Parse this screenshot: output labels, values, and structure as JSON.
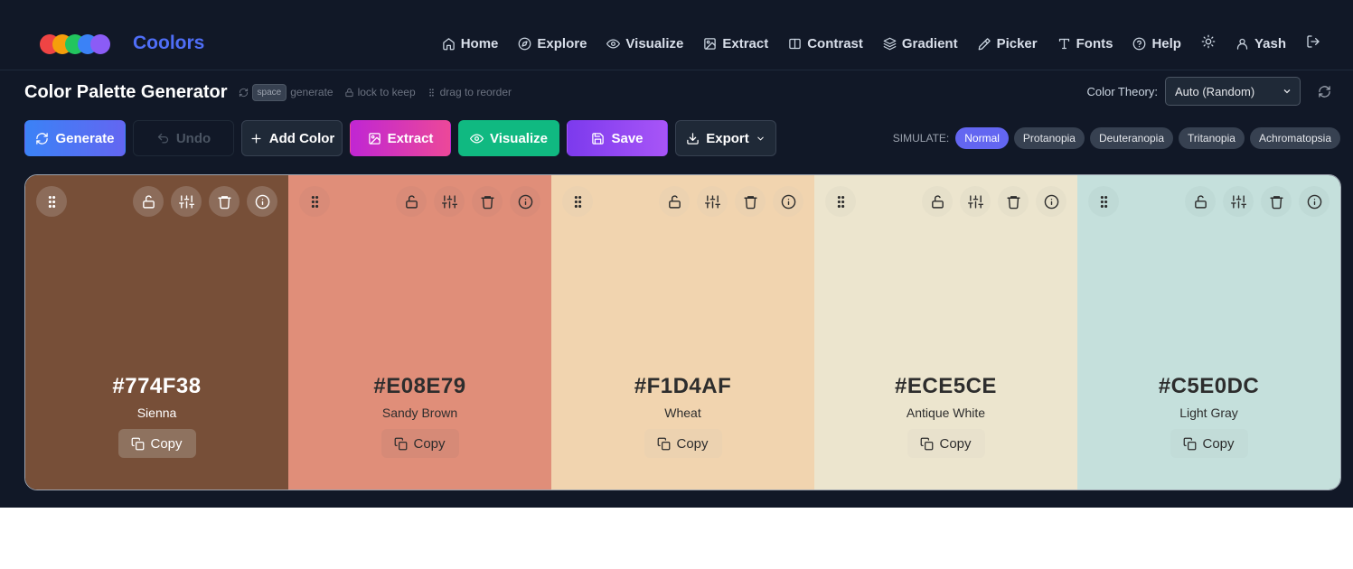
{
  "app": {
    "brand": "Coolors"
  },
  "logo_colors": [
    "#ef4444",
    "#f59e0b",
    "#22c55e",
    "#3b82f6",
    "#8b5cf6"
  ],
  "nav": [
    {
      "label": "Home",
      "icon": "home-icon"
    },
    {
      "label": "Explore",
      "icon": "compass-icon"
    },
    {
      "label": "Visualize",
      "icon": "eye-icon"
    },
    {
      "label": "Extract",
      "icon": "image-icon"
    },
    {
      "label": "Contrast",
      "icon": "contrast-icon"
    },
    {
      "label": "Gradient",
      "icon": "layers-icon"
    },
    {
      "label": "Picker",
      "icon": "pipette-icon"
    },
    {
      "label": "Fonts",
      "icon": "type-icon"
    },
    {
      "label": "Help",
      "icon": "help-icon"
    }
  ],
  "user": {
    "name": "Yash"
  },
  "page": {
    "title": "Color Palette Generator",
    "hints": {
      "space_key": "space",
      "generate": "generate",
      "lock": "lock to keep",
      "drag": "drag to reorder"
    }
  },
  "theory": {
    "label": "Color Theory:",
    "value": "Auto (Random)"
  },
  "toolbar": {
    "generate": "Generate",
    "undo": "Undo",
    "add_color": "Add Color",
    "extract": "Extract",
    "visualize": "Visualize",
    "save": "Save",
    "export": "Export"
  },
  "simulate": {
    "label": "SIMULATE:",
    "options": [
      "Normal",
      "Protanopia",
      "Deuteranopia",
      "Tritanopia",
      "Achromatopsia"
    ],
    "active": "Normal"
  },
  "palette": [
    {
      "hex": "#774F38",
      "name": "Sienna",
      "text_color": "#ffffff",
      "copy_label": "Copy",
      "copy_bg": "#8e725f",
      "circle_bg": "#8c6c5a"
    },
    {
      "hex": "#E08E79",
      "name": "Sandy Brown",
      "text_color": "#2d2d2d",
      "copy_label": "Copy",
      "copy_bg": "#d68a77",
      "circle_bg": "#d98b78"
    },
    {
      "hex": "#F1D4AF",
      "name": "Wheat",
      "text_color": "#2d2d2d",
      "copy_label": "Copy",
      "copy_bg": "#ecd2b0",
      "circle_bg": "#ecd2b0"
    },
    {
      "hex": "#ECE5CE",
      "name": "Antique White",
      "text_color": "#2d2d2d",
      "copy_label": "Copy",
      "copy_bg": "#e8e1cc",
      "circle_bg": "#e6e0ca"
    },
    {
      "hex": "#C5E0DC",
      "name": "Light Gray",
      "text_color": "#2d2d2d",
      "copy_label": "Copy",
      "copy_bg": "#c2dcd8",
      "circle_bg": "#bfdad6"
    }
  ]
}
